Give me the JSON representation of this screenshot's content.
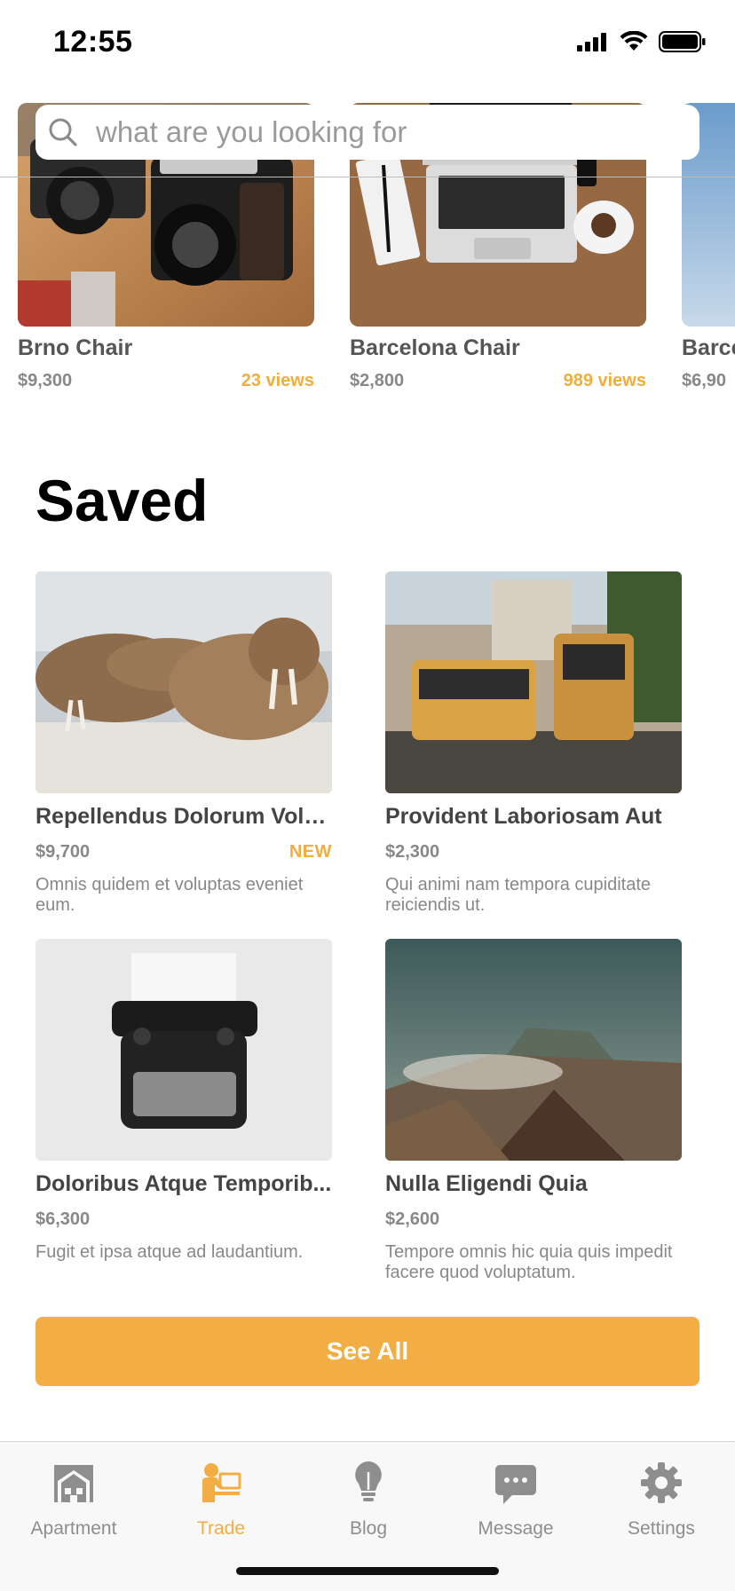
{
  "status_bar": {
    "time": "12:55"
  },
  "search": {
    "placeholder": "what are you looking for"
  },
  "featured": [
    {
      "title": "Brno Chair",
      "price": "$9,300",
      "views": "23 views"
    },
    {
      "title": "Barcelona Chair",
      "price": "$2,800",
      "views": "989 views"
    },
    {
      "title": "Barce",
      "price": "$6,90",
      "views": ""
    }
  ],
  "saved": {
    "title": "Saved",
    "items": [
      {
        "title": "Repellendus Dolorum Volu...",
        "price": "$9,700",
        "badge": "NEW",
        "description": "Omnis quidem et voluptas eveniet eum."
      },
      {
        "title": "Provident Laboriosam Aut",
        "price": "$2,300",
        "badge": "",
        "description": "Qui animi nam tempora cupiditate reiciendis ut."
      },
      {
        "title": "Doloribus Atque Temporib...",
        "price": "$6,300",
        "badge": "",
        "description": "Fugit et ipsa atque ad laudantium."
      },
      {
        "title": "Nulla Eligendi Quia",
        "price": "$2,600",
        "badge": "",
        "description": "Tempore omnis hic quia quis impedit facere quod voluptatum."
      }
    ],
    "see_all_label": "See All"
  },
  "tabs": [
    {
      "label": "Apartment",
      "icon": "apartment-icon",
      "active": false
    },
    {
      "label": "Trade",
      "icon": "trade-icon",
      "active": true
    },
    {
      "label": "Blog",
      "icon": "lightbulb-icon",
      "active": false
    },
    {
      "label": "Message",
      "icon": "message-icon",
      "active": false
    },
    {
      "label": "Settings",
      "icon": "gear-icon",
      "active": false
    }
  ],
  "colors": {
    "accent": "#f2ad44",
    "inactive": "#8e8e8e"
  }
}
